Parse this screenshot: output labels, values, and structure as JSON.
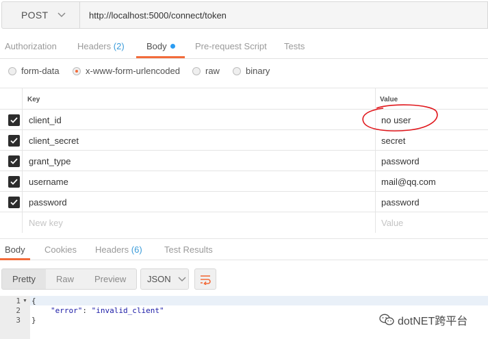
{
  "request": {
    "method": "POST",
    "url": "http://localhost:5000/connect/token"
  },
  "request_tabs": [
    {
      "label": "Authorization"
    },
    {
      "label": "Headers",
      "count": "(2)"
    },
    {
      "label": "Body",
      "active": true
    },
    {
      "label": "Pre-request Script"
    },
    {
      "label": "Tests"
    }
  ],
  "body_types": [
    {
      "label": "form-data",
      "selected": false
    },
    {
      "label": "x-www-form-urlencoded",
      "selected": true
    },
    {
      "label": "raw",
      "selected": false
    },
    {
      "label": "binary",
      "selected": false
    }
  ],
  "params_table": {
    "columns": {
      "key": "Key",
      "value": "Value"
    },
    "rows": [
      {
        "key": "client_id",
        "value": "no user",
        "checked": true
      },
      {
        "key": "client_secret",
        "value": "secret",
        "checked": true
      },
      {
        "key": "grant_type",
        "value": "password",
        "checked": true
      },
      {
        "key": "username",
        "value": "mail@qq.com",
        "checked": true
      },
      {
        "key": "password",
        "value": "password",
        "checked": true
      }
    ],
    "new_row": {
      "key_placeholder": "New key",
      "value_placeholder": "Value"
    }
  },
  "response_tabs": [
    {
      "label": "Body",
      "active": true
    },
    {
      "label": "Cookies"
    },
    {
      "label": "Headers",
      "count": "(6)"
    },
    {
      "label": "Test Results"
    }
  ],
  "response_toolbar": {
    "views": [
      "Pretty",
      "Raw",
      "Preview"
    ],
    "active_view": "Pretty",
    "format": "JSON"
  },
  "response_body": {
    "line_numbers": [
      "1",
      "2",
      "3"
    ],
    "lines": {
      "open": "{",
      "key": "\"error\"",
      "sep": ": ",
      "value": "\"invalid_client\"",
      "close": "}"
    }
  },
  "watermark": "dotNET跨平台",
  "colors": {
    "accent": "#f26b3a",
    "count_blue": "#3a9bd9",
    "dot_blue": "#2b9cf2",
    "annotation": "#e0161b"
  },
  "icons": {
    "method_dropdown": "chevron-down-icon",
    "format_dropdown": "chevron-down-icon",
    "wrap": "wrap-lines-icon",
    "checkbox": "check-icon",
    "watermark": "wechat-icon"
  }
}
